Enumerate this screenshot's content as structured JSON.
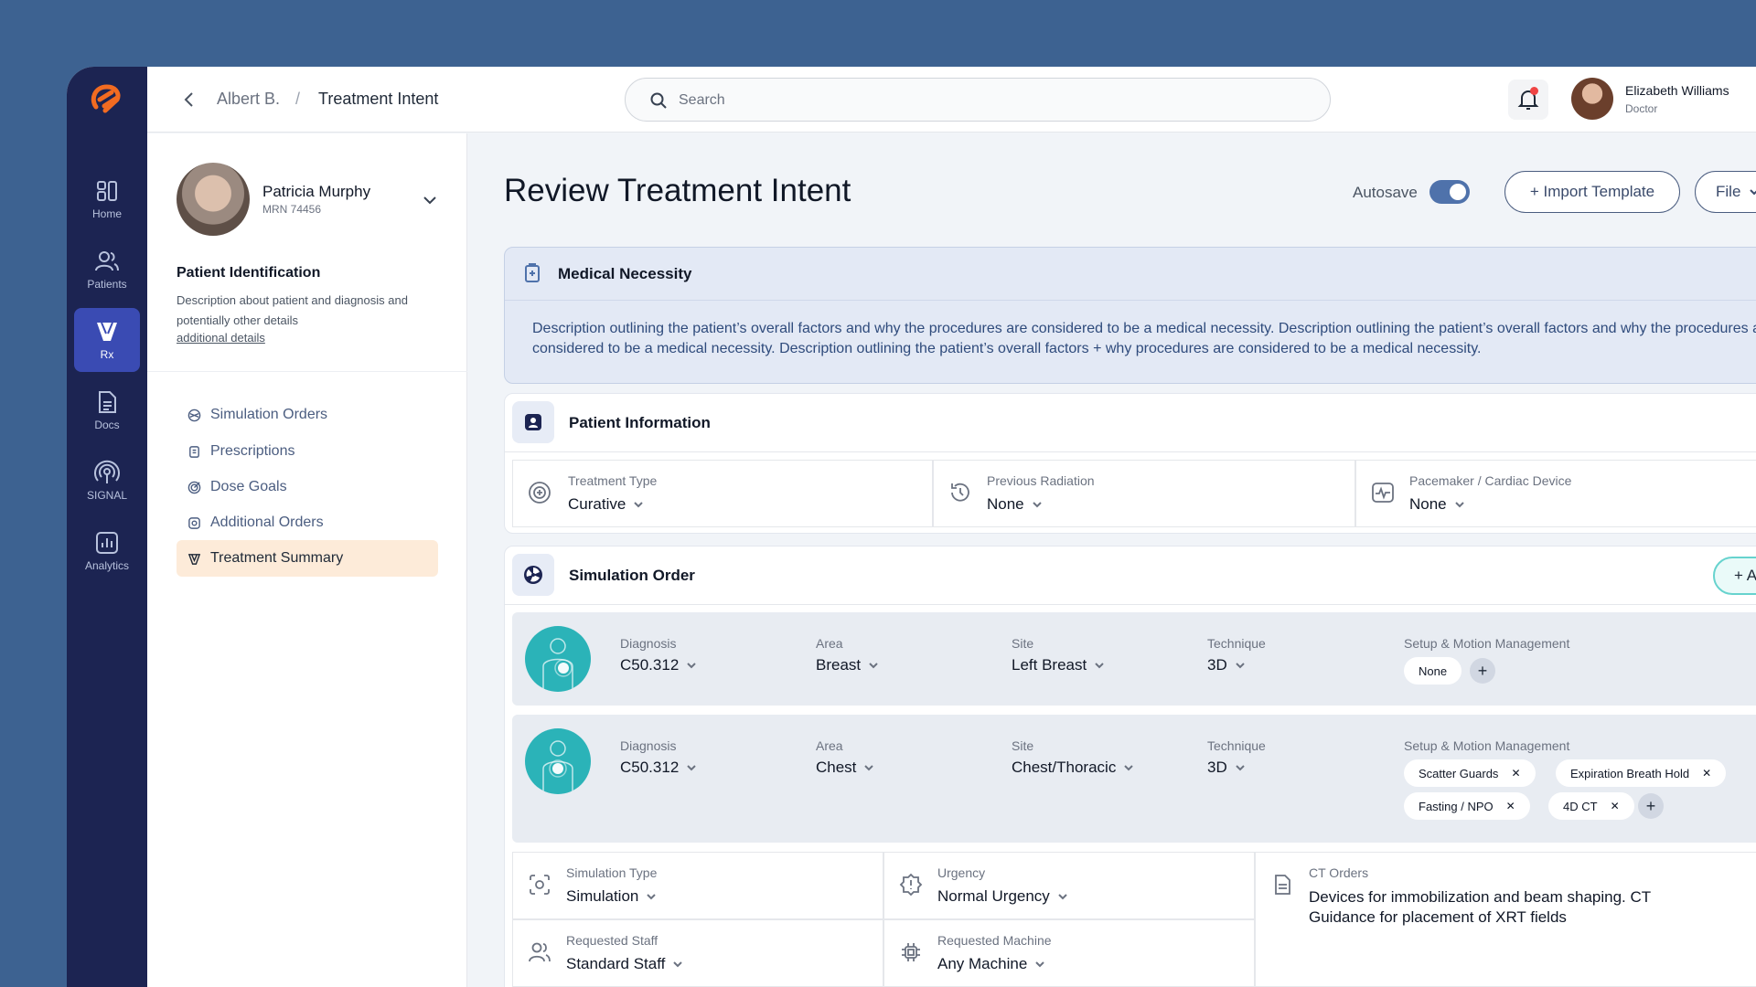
{
  "nav_rail": {
    "items": [
      {
        "label": "Home",
        "icon": "home-icon"
      },
      {
        "label": "Patients",
        "icon": "patients-icon"
      },
      {
        "label": "Rx",
        "icon": "rx-icon"
      },
      {
        "label": "Docs",
        "icon": "docs-icon"
      },
      {
        "label": "SIGNAL",
        "icon": "signal-icon"
      },
      {
        "label": "Analytics",
        "icon": "analytics-icon"
      }
    ],
    "active": "Rx"
  },
  "topbar": {
    "breadcrumb": [
      "Albert B.",
      "/",
      "Treatment Intent"
    ],
    "search_placeholder": "Search",
    "user": {
      "name": "Elizabeth Williams",
      "role": "Doctor"
    },
    "has_notification": true
  },
  "patient": {
    "name": "Patricia Murphy",
    "mrn": "MRN 74456",
    "identification_title": "Patient Identification",
    "identification_desc": "Description about patient and diagnosis and potentially other details",
    "additional_link": "additional details"
  },
  "left_nav": {
    "items": [
      "Simulation Orders",
      "Prescriptions",
      "Dose Goals",
      "Additional Orders",
      "Treatment Summary"
    ],
    "active": "Treatment Summary"
  },
  "main": {
    "title": "Review Treatment Intent",
    "autosave_label": "Autosave",
    "autosave_on": true,
    "import_label": "+ Import Template",
    "file_label": "File"
  },
  "medical_necessity": {
    "title": "Medical Necessity",
    "description": "Description outlining the patient’s overall factors and why the procedures are considered to be a medical necessity. Description outlining the patient’s overall factors and why the procedures are considered to be a medical necessity. Description outlining the patient’s overall factors + why procedures are considered to be a medical necessity."
  },
  "patient_information": {
    "title": "Patient Information",
    "fields": [
      {
        "label": "Treatment Type",
        "value": "Curative"
      },
      {
        "label": "Previous Radiation",
        "value": "None"
      },
      {
        "label": "Pacemaker / Cardiac Device",
        "value": "None"
      }
    ]
  },
  "simulation_order": {
    "title": "Simulation Order",
    "add_label": "+ Add",
    "rows": [
      {
        "diagnosis_label": "Diagnosis",
        "diagnosis": "C50.312",
        "area_label": "Area",
        "area": "Breast",
        "site_label": "Site",
        "site": "Left Breast",
        "technique_label": "Technique",
        "technique": "3D",
        "setup_label": "Setup & Motion Management",
        "chips": [
          "None"
        ]
      },
      {
        "diagnosis_label": "Diagnosis",
        "diagnosis": "C50.312",
        "area_label": "Area",
        "area": "Chest",
        "site_label": "Site",
        "site": "Chest/Thoracic",
        "technique_label": "Technique",
        "technique": "3D",
        "setup_label": "Setup & Motion Management",
        "chips": [
          "Scatter Guards",
          "Expiration Breath Hold",
          "Fasting / NPO",
          "4D CT"
        ]
      }
    ],
    "details": [
      {
        "label": "Simulation Type",
        "value": "Simulation"
      },
      {
        "label": "Urgency",
        "value": "Normal Urgency"
      },
      {
        "label": "Requested Staff",
        "value": "Standard Staff"
      },
      {
        "label": "Requested Machine",
        "value": "Any Machine"
      }
    ],
    "ct_orders": {
      "label": "CT Orders",
      "text": "Devices for immobilization and beam shaping. CT Guidance for placement of XRT fields"
    }
  },
  "colors": {
    "background": "#3d6291",
    "rail": "#1c2452",
    "rail_active": "#3a4bb3",
    "accent_orange": "#f26b21",
    "teal": "#2bb3b8",
    "active_nav_bg": "#fdebd9"
  }
}
